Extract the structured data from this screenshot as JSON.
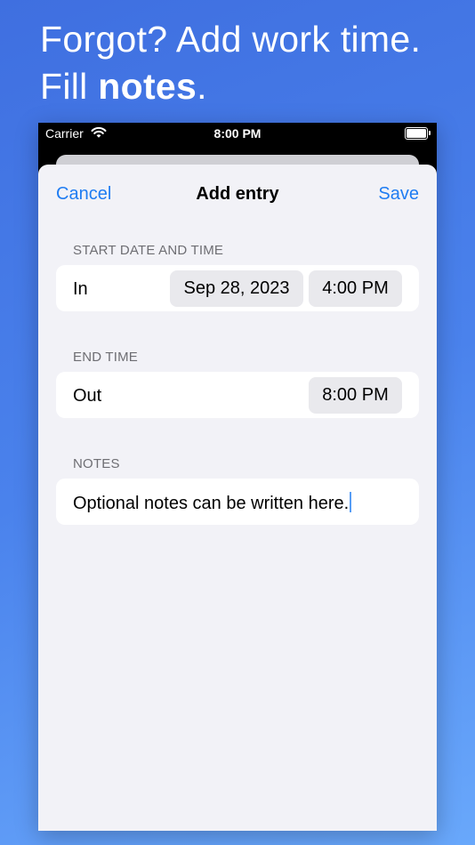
{
  "headline": {
    "line1": "Forgot? Add work time.",
    "line2_prefix": "Fill ",
    "line2_bold": "notes",
    "line2_suffix": "."
  },
  "status_bar": {
    "carrier": "Carrier",
    "time": "8:00 PM",
    "icons": [
      "wifi-icon",
      "battery-icon"
    ]
  },
  "nav": {
    "cancel_label": "Cancel",
    "title": "Add entry",
    "save_label": "Save"
  },
  "start": {
    "section_label": "START DATE AND TIME",
    "row_label": "In",
    "date_value": "Sep 28, 2023",
    "time_value": "4:00 PM"
  },
  "end": {
    "section_label": "END TIME",
    "row_label": "Out",
    "time_value": "8:00 PM"
  },
  "notes": {
    "section_label": "NOTES",
    "value": "Optional notes can be written here."
  },
  "colors": {
    "accent": "#1f7cf2",
    "background_top": "#3f6fe0",
    "background_bottom": "#69a8fb",
    "sheet_background": "#f2f2f7",
    "pill_background": "#e9e9ed"
  }
}
